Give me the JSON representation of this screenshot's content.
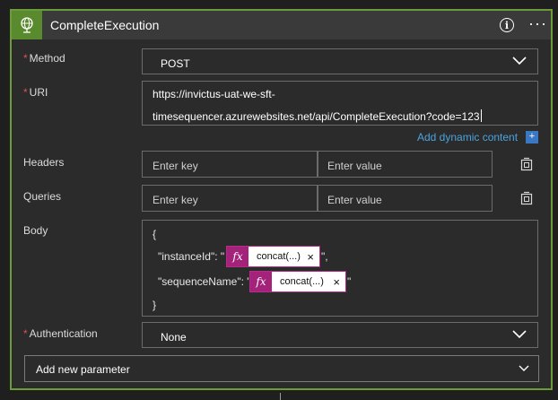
{
  "header": {
    "title": "CompleteExecution",
    "icon": "globe-icon",
    "accent": "#5a8a2e",
    "border": "#6c9c3a"
  },
  "method": {
    "label": "Method",
    "value": "POST"
  },
  "uri": {
    "label": "URI",
    "line1": "https://invictus-uat-we-sft-",
    "line2": "timesequencer.azurewebsites.net/api/CompleteExecution?code=123"
  },
  "dynamic_content": {
    "label": "Add dynamic content",
    "plus": "+"
  },
  "headers": {
    "label": "Headers",
    "key_placeholder": "Enter key",
    "value_placeholder": "Enter value"
  },
  "queries": {
    "label": "Queries",
    "key_placeholder": "Enter key",
    "value_placeholder": "Enter value"
  },
  "body": {
    "label": "Body",
    "open_brace": "{",
    "close_brace": "}",
    "line1_key": "\"instanceId\": \"",
    "line1_end": "\",",
    "line2_key": "\"sequenceName\": \"",
    "line2_end": "\"",
    "token1": {
      "fx": "fx",
      "label": "concat(...)",
      "close": "×"
    },
    "token2": {
      "fx": "fx",
      "label": "concat(...)",
      "close": "×"
    }
  },
  "authentication": {
    "label": "Authentication",
    "value": "None"
  },
  "add_parameter": {
    "label": "Add new parameter"
  },
  "required_marker": "*"
}
